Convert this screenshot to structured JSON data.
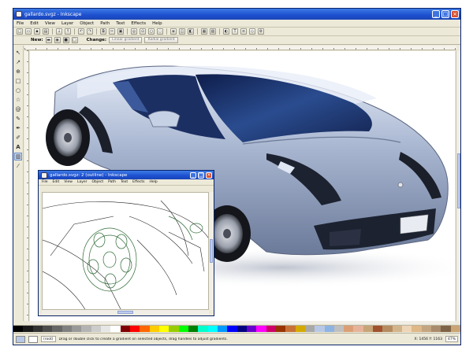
{
  "main_window": {
    "title": "gallardo.svgz - Inkscape",
    "menu": [
      "File",
      "Edit",
      "View",
      "Layer",
      "Object",
      "Path",
      "Text",
      "Effects",
      "Help"
    ],
    "controls": {
      "new_label": "New:",
      "change_label": "Change:",
      "buttons": [
        "Linear gradient",
        "Radial gradient"
      ]
    },
    "commands_icons": [
      "new-icon",
      "open-icon",
      "save-icon",
      "print-icon",
      "import-icon",
      "export-icon",
      "undo-icon",
      "redo-icon",
      "copy-icon",
      "cut-icon",
      "paste-icon",
      "zoom-icon",
      "zoom-fit-icon",
      "duplicate-icon",
      "clone-icon",
      "group-icon",
      "ungroup-icon",
      "fill-stroke-icon",
      "text-icon",
      "align-icon",
      "xml-icon",
      "prefs-icon"
    ],
    "tools": [
      "selector-icon",
      "node-icon",
      "zoom-icon",
      "rect-icon",
      "ellipse-icon",
      "star-icon",
      "spiral-icon",
      "pencil-icon",
      "pen-icon",
      "calligraphy-icon",
      "text-tool-icon",
      "gradient-icon",
      "dropper-icon"
    ],
    "active_tool": "gradient-icon",
    "status": {
      "layer": "(root)",
      "message": "Drag or double click to create a gradient on selected objects, drag handles to adjust gradients.",
      "coords": "X: 1456   Y: 1163",
      "zoom": "47%"
    },
    "palette": [
      "#000000",
      "#1a1a1a",
      "#333333",
      "#4d4d4d",
      "#666666",
      "#808080",
      "#999999",
      "#b3b3b3",
      "#cccccc",
      "#e6e6e6",
      "#ffffff",
      "#800000",
      "#ff0000",
      "#ff6600",
      "#ffcc00",
      "#ffff00",
      "#99cc00",
      "#00ff00",
      "#008000",
      "#00ffcc",
      "#00ffff",
      "#0099ff",
      "#0000ff",
      "#000080",
      "#6600cc",
      "#ff00ff",
      "#cc0066",
      "#993300",
      "#c87137",
      "#d4aa00",
      "#a8a8a8",
      "#b7c8e6",
      "#8db3e2",
      "#bfbfbf",
      "#dc9f75",
      "#e6b39a",
      "#c6a477",
      "#a0522d",
      "#b58b5f",
      "#d2b48c",
      "#eed5b7",
      "#deb887",
      "#c4a582",
      "#a98c6d",
      "#7f6347",
      "#caa472"
    ]
  },
  "outline_window": {
    "title": "gallardo.svgz: 2 (outline) - Inkscape",
    "menu": [
      "File",
      "Edit",
      "View",
      "Layer",
      "Object",
      "Path",
      "Text",
      "Effects",
      "Help"
    ]
  }
}
